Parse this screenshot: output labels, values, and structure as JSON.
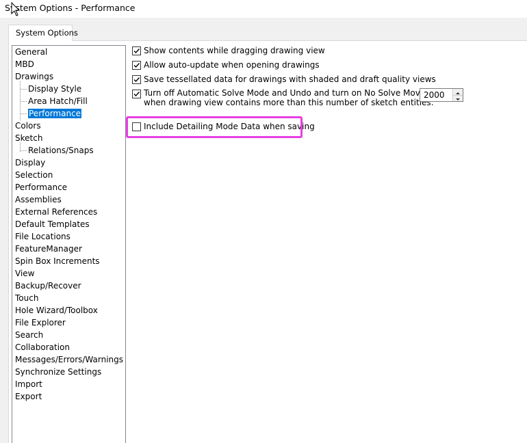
{
  "window": {
    "title": "System Options - Performance"
  },
  "tabs": [
    {
      "label": "System Options"
    }
  ],
  "tree": {
    "items": [
      {
        "label": "General"
      },
      {
        "label": "MBD"
      },
      {
        "label": "Drawings"
      },
      {
        "label": "Display Style"
      },
      {
        "label": "Area Hatch/Fill"
      },
      {
        "label": "Performance"
      },
      {
        "label": "Colors"
      },
      {
        "label": "Sketch"
      },
      {
        "label": "Relations/Snaps"
      },
      {
        "label": "Display"
      },
      {
        "label": "Selection"
      },
      {
        "label": "Performance"
      },
      {
        "label": "Assemblies"
      },
      {
        "label": "External References"
      },
      {
        "label": "Default Templates"
      },
      {
        "label": "File Locations"
      },
      {
        "label": "FeatureManager"
      },
      {
        "label": "Spin Box Increments"
      },
      {
        "label": "View"
      },
      {
        "label": "Backup/Recover"
      },
      {
        "label": "Touch"
      },
      {
        "label": "Hole Wizard/Toolbox"
      },
      {
        "label": "File Explorer"
      },
      {
        "label": "Search"
      },
      {
        "label": "Collaboration"
      },
      {
        "label": "Messages/Errors/Warnings"
      },
      {
        "label": "Synchronize Settings"
      },
      {
        "label": "Import"
      },
      {
        "label": "Export"
      }
    ],
    "selected": "Drawings > Performance"
  },
  "options": {
    "show_contents": {
      "label": "Show contents while dragging drawing view",
      "checked": true
    },
    "auto_update": {
      "label": "Allow auto-update when opening drawings",
      "checked": true
    },
    "save_tessellated": {
      "label": "Save tessellated data for drawings with shaded and draft quality views",
      "checked": true
    },
    "turn_off_solve": {
      "label_line1": "Turn off Automatic Solve Mode and Undo and turn on No Solve Move",
      "label_line2": "when drawing view contains more than this number of sketch entities:",
      "checked": true,
      "value": "2000"
    },
    "include_detailing": {
      "label": "Include Detailing Mode Data when saving",
      "checked": false
    }
  },
  "colors": {
    "highlight": "#e83fe3",
    "selection": "#0078d7"
  }
}
